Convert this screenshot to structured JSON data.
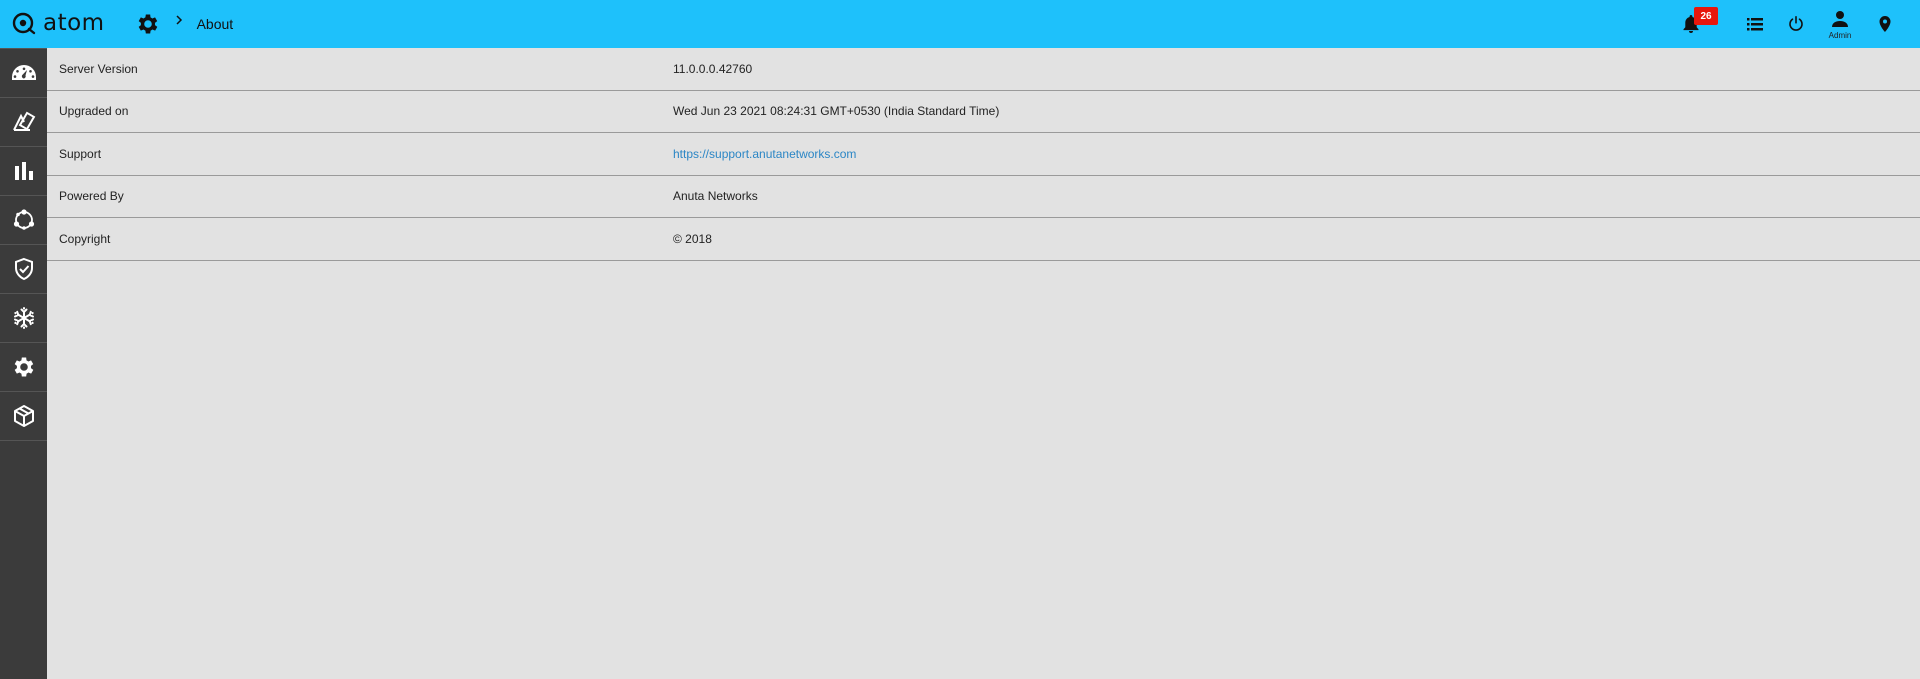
{
  "app": {
    "name": "atom"
  },
  "breadcrumb": {
    "current": "About"
  },
  "header": {
    "notifications_count": "26",
    "user_label": "Admin"
  },
  "icons": {
    "logo": "atom-logo-icon",
    "breadcrumb": "gear-icon",
    "separator": "chevron-right-icon",
    "right": [
      "bell-icon",
      "list-icon",
      "power-icon",
      "user-icon",
      "location-pin-icon"
    ],
    "sidebar": [
      "dashboard-gauge-icon",
      "resources-icon",
      "bar-chart-icon",
      "network-nodes-icon",
      "shield-check-icon",
      "snowflake-icon",
      "gear-icon",
      "package-cube-icon"
    ]
  },
  "about": {
    "rows": [
      {
        "label": "Server Version",
        "value": "11.0.0.0.42760"
      },
      {
        "label": "Upgraded on",
        "value": "Wed Jun 23 2021 08:24:31 GMT+0530 (India Standard Time)"
      },
      {
        "label": "Support",
        "value": "https://support.anutanetworks.com"
      },
      {
        "label": "Powered By",
        "value": "Anuta Networks"
      },
      {
        "label": "Copyright",
        "value": "© 2018"
      }
    ]
  },
  "colors": {
    "topbar": "#1ec1fb",
    "sidebar": "#3b3b3b",
    "content_bg": "#e2e2e2",
    "badge": "#e8160c",
    "link": "#2b86c5"
  }
}
